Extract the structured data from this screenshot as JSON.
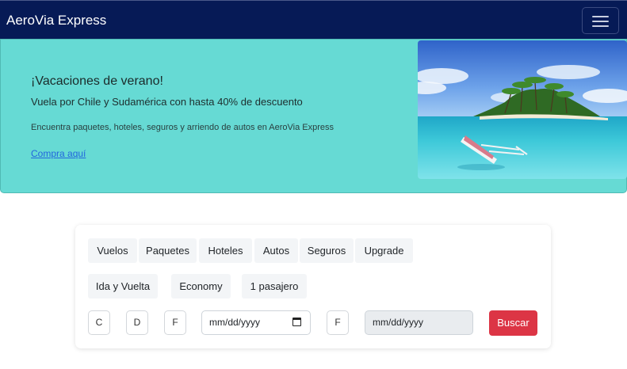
{
  "navbar": {
    "brand": "AeroVia Express",
    "menu_icon": "hamburger-menu-icon"
  },
  "promo": {
    "title": "¡Vacaciones de verano!",
    "subtitle": "Vuela por Chile y Sudamérica con hasta 40% de descuento",
    "description": "Encuentra paquetes, hoteles, seguros y arriendo de autos en AeroVia Express",
    "link_label": "Compra aquí",
    "image_subject": "tropical-island-beach-with-outrigger-canoe"
  },
  "search": {
    "tabs": [
      "Vuelos",
      "Paquetes",
      "Hoteles",
      "Autos",
      "Seguros",
      "Upgrade"
    ],
    "trip_type": "Ida y Vuelta",
    "cabin_class": "Economy",
    "passengers": "1 pasajero",
    "fields": [
      "C",
      "D",
      "F"
    ],
    "departure_placeholder": "mm/dd/yyyy",
    "return_field": "F",
    "return_placeholder": "mm/dd/yyyy",
    "search_label": "Buscar"
  },
  "colors": {
    "navbar_bg": "#061a56",
    "promo_bg": "#66dad4",
    "search_button": "#dc3545",
    "link": "#2266dd"
  }
}
